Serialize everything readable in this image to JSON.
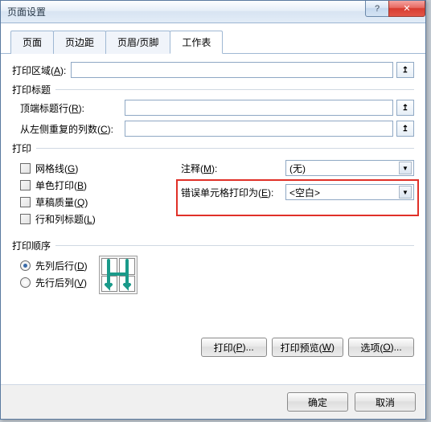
{
  "window": {
    "title": "页面设置"
  },
  "tabs": [
    {
      "label": "页面"
    },
    {
      "label": "页边距"
    },
    {
      "label": "页眉/页脚"
    },
    {
      "label": "工作表"
    }
  ],
  "printArea": {
    "label": "打印区域(",
    "hotkey": "A",
    "suffix": "):",
    "value": ""
  },
  "printTitles": {
    "group": "打印标题",
    "topRow": {
      "label": "顶端标题行(",
      "hotkey": "R",
      "suffix": "):",
      "value": ""
    },
    "leftCol": {
      "label": "从左侧重复的列数(",
      "hotkey": "C",
      "suffix": "):",
      "value": ""
    }
  },
  "printGroup": {
    "label": "打印"
  },
  "checks": {
    "grid": {
      "label": "网格线(",
      "hotkey": "G",
      "suffix": ")"
    },
    "mono": {
      "label": "单色打印(",
      "hotkey": "B",
      "suffix": ")"
    },
    "draft": {
      "label": "草稿质量(",
      "hotkey": "Q",
      "suffix": ")"
    },
    "rowcol": {
      "label": "行和列标题(",
      "hotkey": "L",
      "suffix": ")"
    }
  },
  "dd1": {
    "label": "注释(",
    "hotkey": "M",
    "suffix": "):",
    "value": "(无)"
  },
  "dd2": {
    "label": "错误单元格打印为(",
    "hotkey": "E",
    "suffix": "):",
    "value": "<空白>"
  },
  "orderGroup": {
    "label": "打印顺序"
  },
  "radios": {
    "down": {
      "label": "先列后行(",
      "hotkey": "D",
      "suffix": ")"
    },
    "over": {
      "label": "先行后列(",
      "hotkey": "V",
      "suffix": ")"
    }
  },
  "buttons": {
    "print": {
      "pre": "打印(",
      "hotkey": "P",
      "suf": ")..."
    },
    "preview": {
      "pre": "打印预览(",
      "hotkey": "W",
      "suf": ")"
    },
    "options": {
      "pre": "选项(",
      "hotkey": "O",
      "suf": ")..."
    },
    "ok": "确定",
    "cancel": "取消"
  }
}
